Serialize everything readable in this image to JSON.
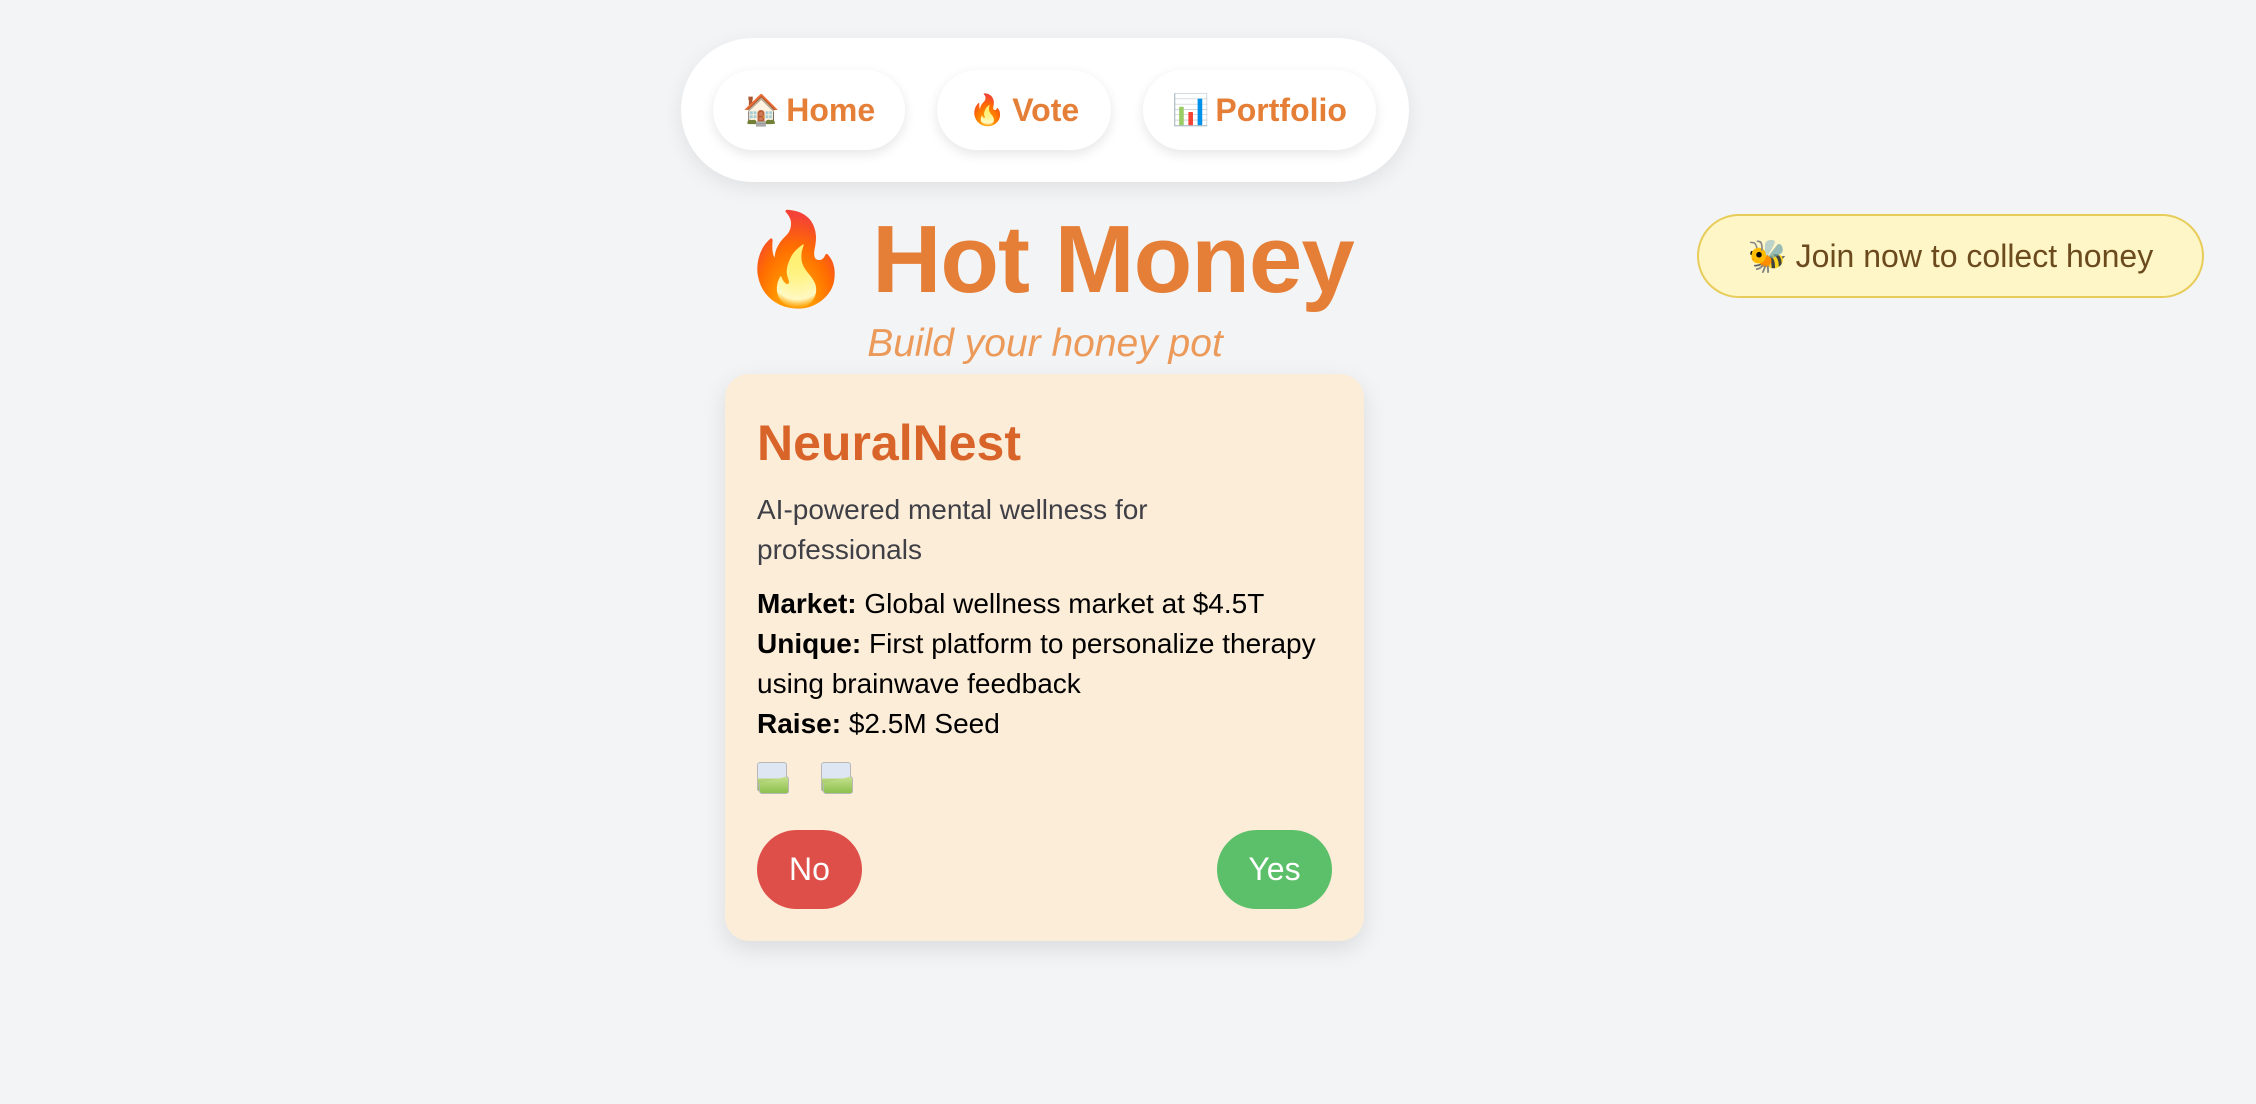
{
  "nav": {
    "items": [
      {
        "icon": "house-icon",
        "emoji": "🏠",
        "label": "Home"
      },
      {
        "icon": "fire-icon",
        "emoji": "🔥",
        "label": "Vote"
      },
      {
        "icon": "bar-chart-icon",
        "emoji": "📊",
        "label": "Portfolio"
      }
    ]
  },
  "header": {
    "emoji": "🔥",
    "title": "Hot Money",
    "subtitle": "Build your honey pot"
  },
  "join": {
    "emoji": "🐝",
    "label": "Join now to collect honey"
  },
  "card": {
    "name": "NeuralNest",
    "tagline": "AI-powered mental wellness for professionals",
    "market_label": "Market:",
    "market_value": "Global wellness market at $4.5T",
    "unique_label": "Unique:",
    "unique_value": "First platform to personalize therapy using brainwave feedback",
    "raise_label": "Raise:",
    "raise_value": "$2.5M Seed",
    "no_label": "No",
    "yes_label": "Yes"
  },
  "colors": {
    "accent": "#e57f37",
    "card_bg": "#fcedd9",
    "no": "#df4f4a",
    "yes": "#5cc06a",
    "join_bg": "#fef6c6"
  }
}
